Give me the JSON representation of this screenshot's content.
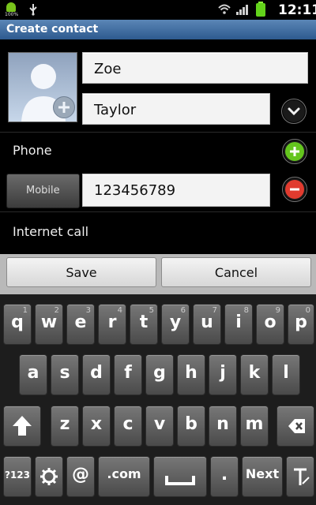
{
  "status": {
    "time": "12:11",
    "battery_label": "100%"
  },
  "screen": {
    "title": "Create contact"
  },
  "contact": {
    "first_name": "Zoe",
    "last_name": "Taylor",
    "phone_label": "Phone",
    "phone_type": "Mobile",
    "phone_number": "123456789",
    "internet_call_label": "Internet call"
  },
  "actions": {
    "save": "Save",
    "cancel": "Cancel"
  },
  "keyboard": {
    "row1": [
      {
        "label": "q",
        "num": "1"
      },
      {
        "label": "w",
        "num": "2"
      },
      {
        "label": "e",
        "num": "3"
      },
      {
        "label": "r",
        "num": "4"
      },
      {
        "label": "t",
        "num": "5"
      },
      {
        "label": "y",
        "num": "6"
      },
      {
        "label": "u",
        "num": "7"
      },
      {
        "label": "i",
        "num": "8"
      },
      {
        "label": "o",
        "num": "9"
      },
      {
        "label": "p",
        "num": "0"
      }
    ],
    "row2": [
      "a",
      "s",
      "d",
      "f",
      "g",
      "h",
      "j",
      "k",
      "l"
    ],
    "row3": [
      "z",
      "x",
      "c",
      "v",
      "b",
      "n",
      "m"
    ],
    "row4": {
      "mode": "?123",
      "at": "@",
      "dotcom": ".com",
      "period": ".",
      "next": "Next"
    }
  }
}
